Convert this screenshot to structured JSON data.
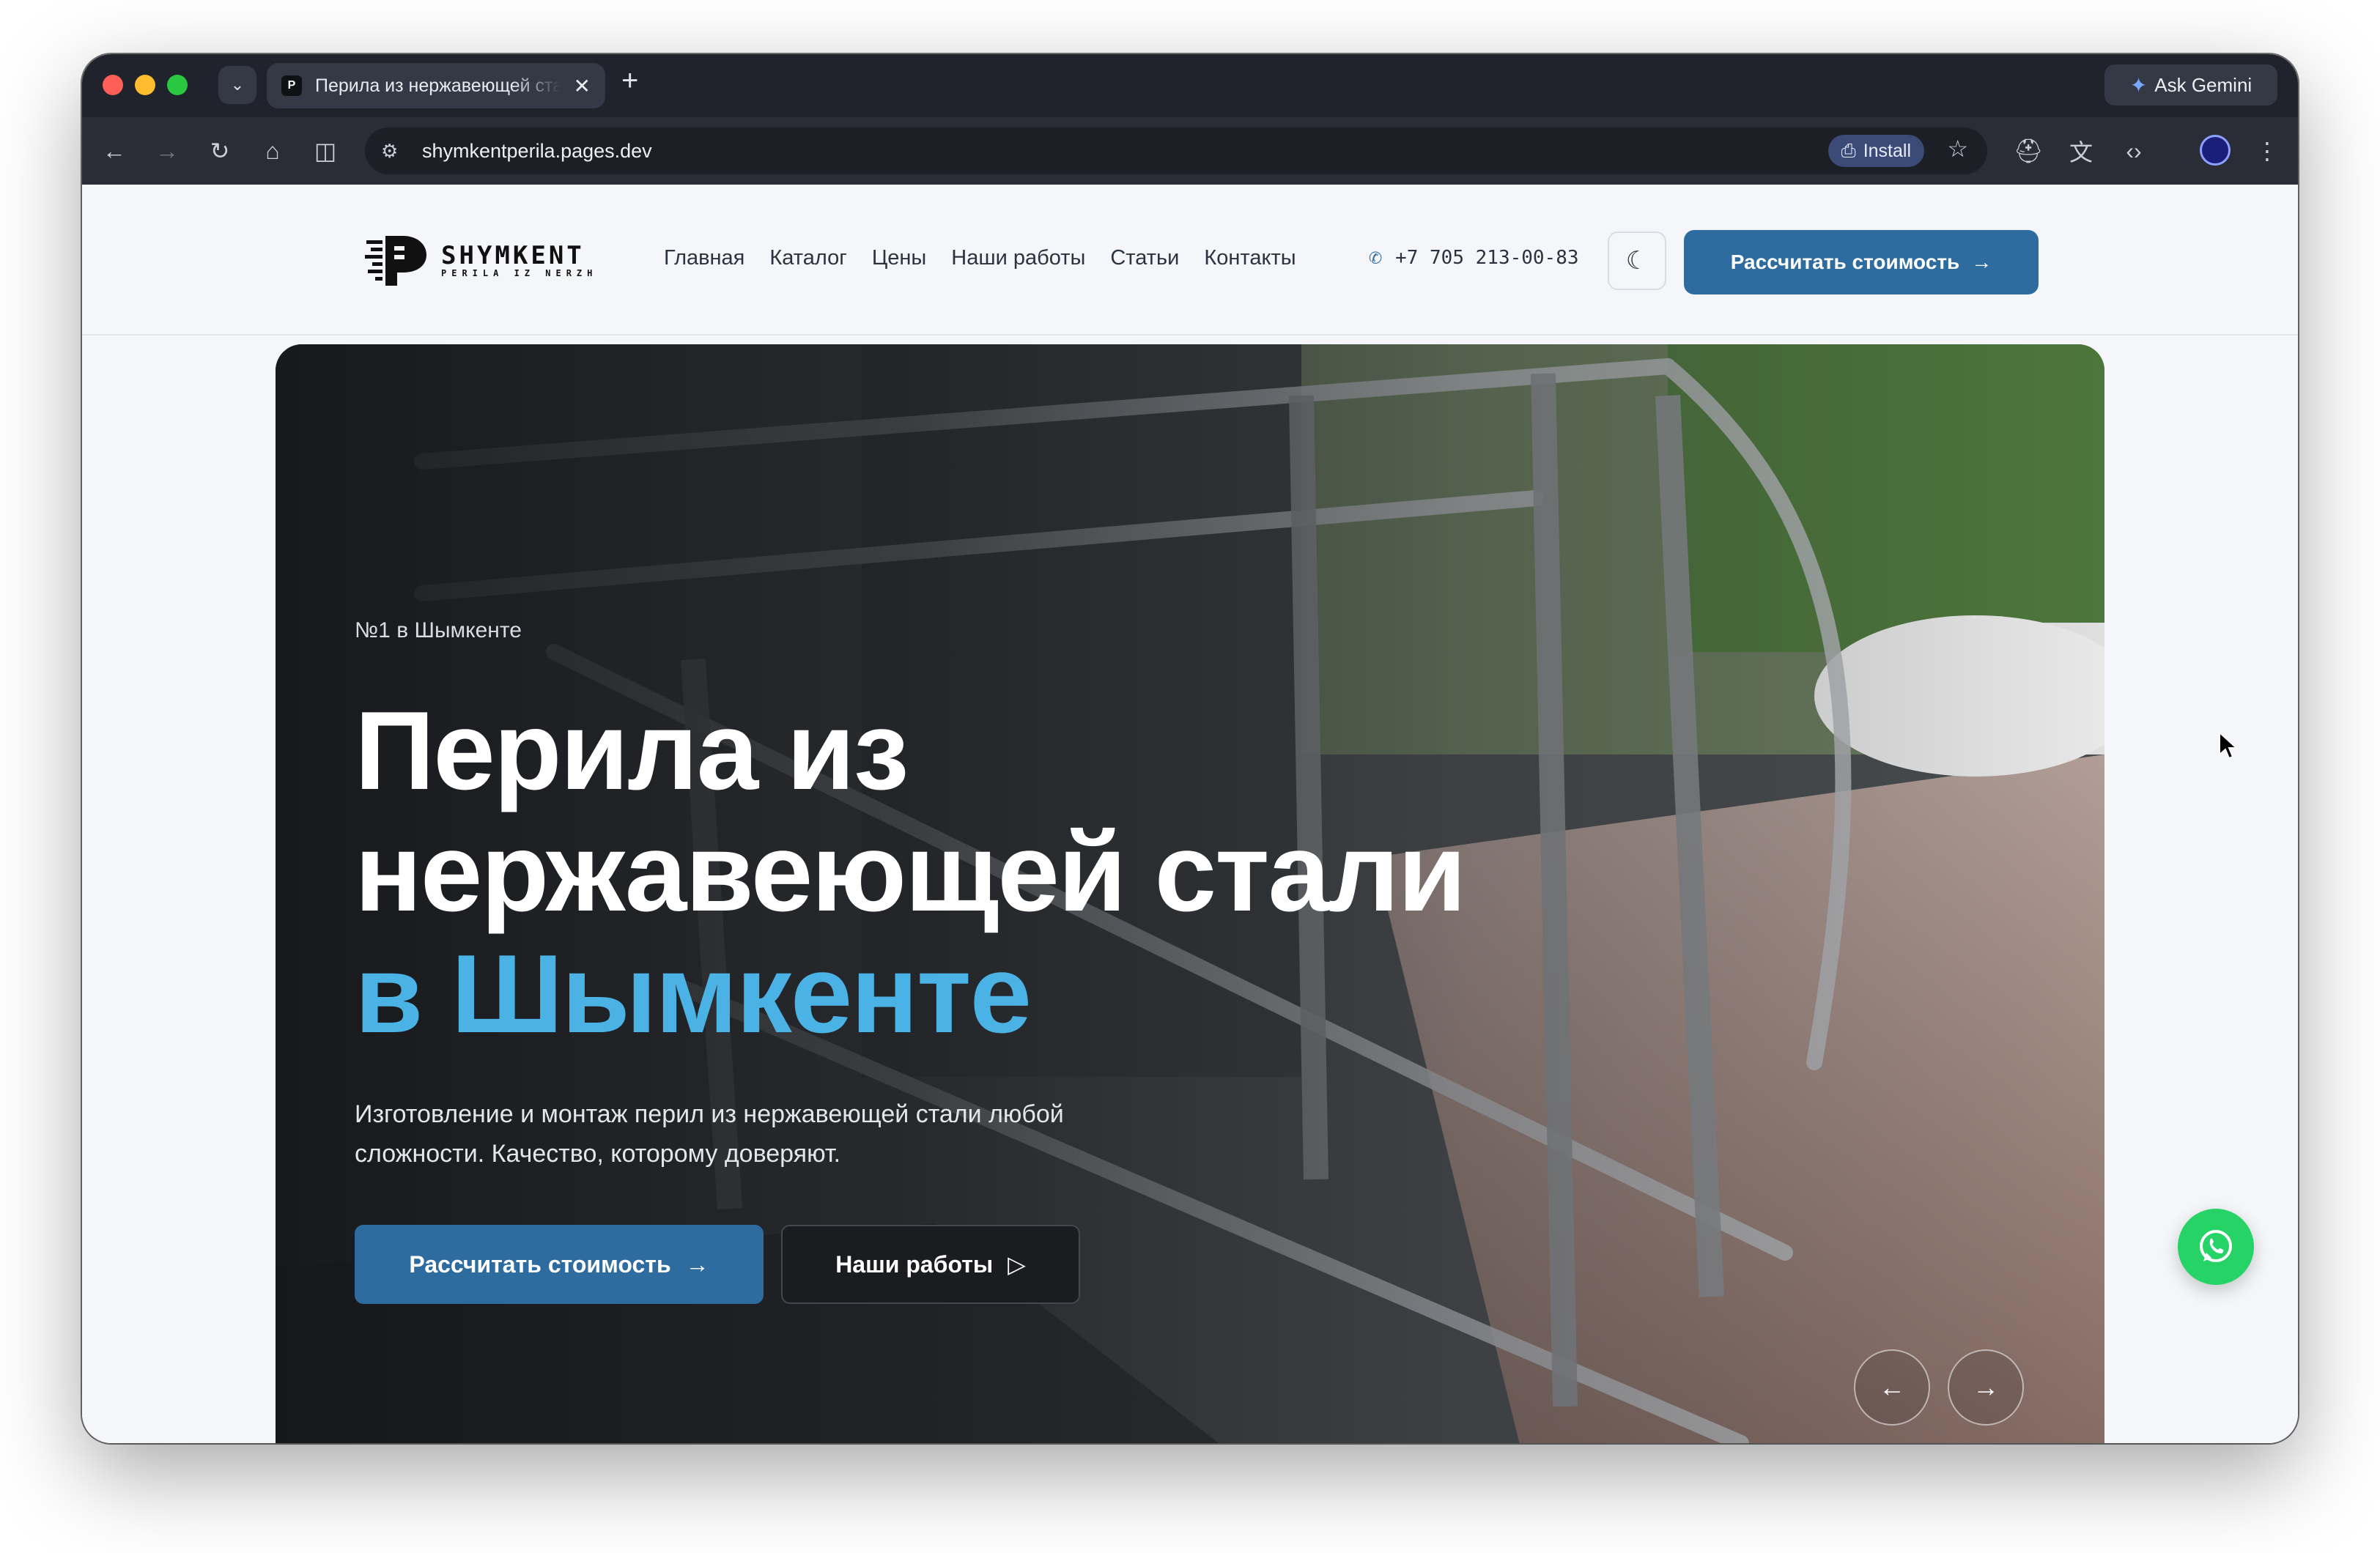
{
  "browser": {
    "tab_title": "Перила из нержавеющей стали",
    "tab_close": "✕",
    "new_tab": "+",
    "ask_gemini": "Ask Gemini",
    "url": "shymkentperila.pages.dev",
    "install_label": "Install"
  },
  "header": {
    "logo_name": "SHYMKENT",
    "logo_sub": "PERILA IZ NERZH",
    "nav": [
      "Главная",
      "Каталог",
      "Цены",
      "Наши работы",
      "Статьи",
      "Контакты"
    ],
    "phone": "+7 705 213-00-83",
    "cta": "Рассчитать стоимость",
    "cta_arrow": "→"
  },
  "hero": {
    "badge": "№1 в Шымкенте",
    "headline_line1": "Перила из",
    "headline_line2": "нержавеющей стали",
    "headline_accent": "в Шымкенте",
    "lead": "Изготовление и монтаж перил из нержавеющей стали любой сложности. Качество, которому доверяют.",
    "btn_primary": "Рассчитать стоимость",
    "btn_primary_arrow": "→",
    "btn_secondary": "Наши работы",
    "btn_secondary_icon": "▷",
    "slider_prev": "←",
    "slider_next": "→"
  },
  "colors": {
    "accent": "#4bb2e6",
    "primary": "#2e6c9f",
    "whatsapp": "#25d366"
  },
  "icons": [
    "back-icon",
    "forward-icon",
    "reload-icon",
    "home-icon",
    "split-view-icon",
    "site-settings-icon",
    "install-icon",
    "bookmark-star-icon",
    "incognito-icon",
    "translate-icon",
    "devtools-icon",
    "profile-avatar-icon",
    "menu-icon",
    "phone-icon",
    "moon-icon",
    "arrow-right-icon",
    "play-icon",
    "whatsapp-icon",
    "cursor-icon"
  ]
}
